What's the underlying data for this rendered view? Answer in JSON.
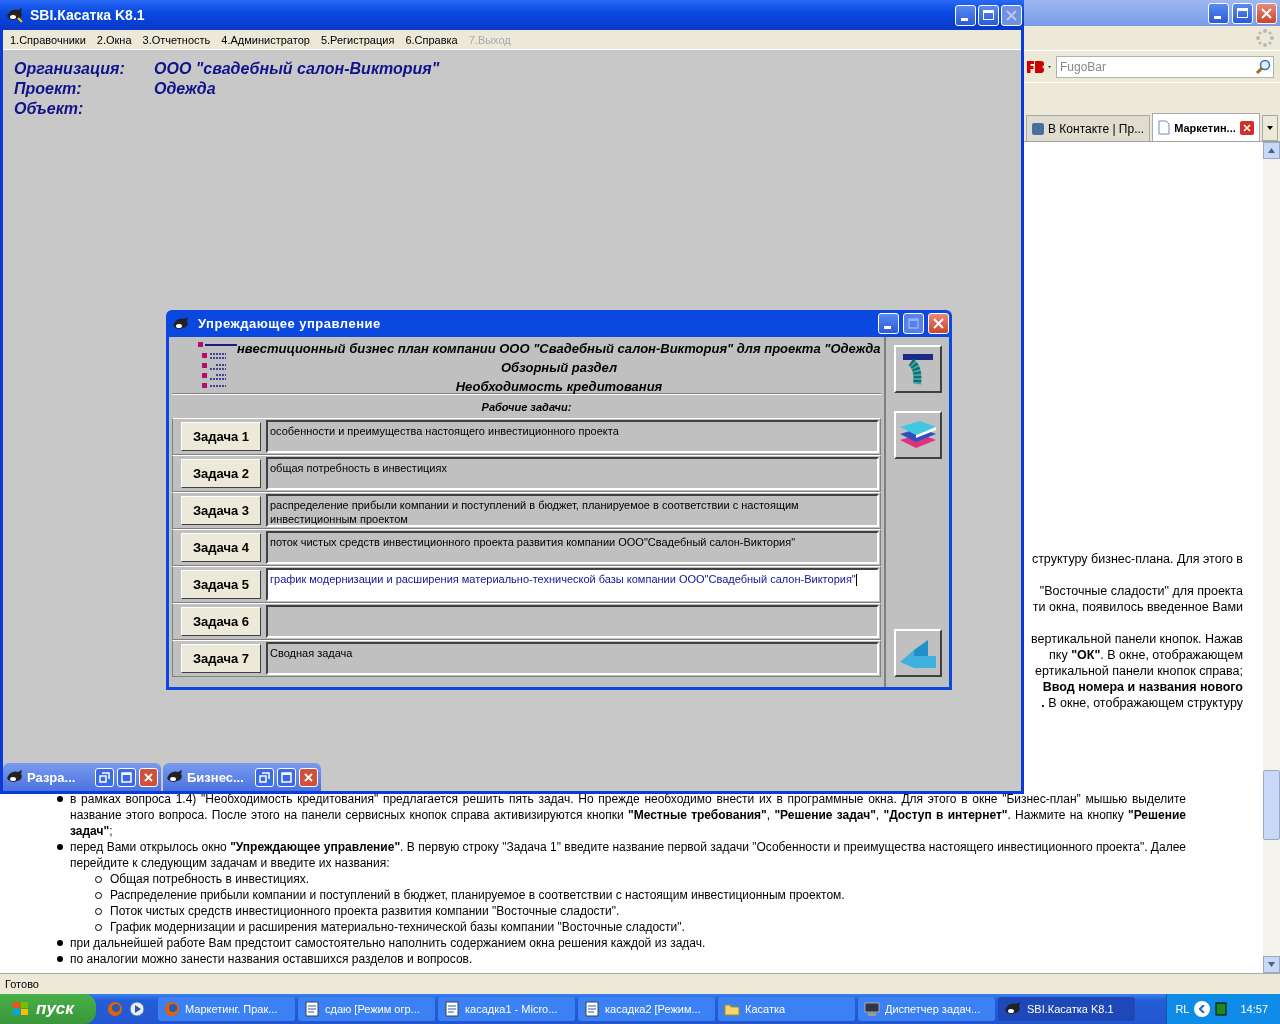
{
  "browser": {
    "search": {
      "placeholder": "FugoBar"
    },
    "tabs": [
      {
        "label": "В Контакте | Пр...",
        "selected": false
      },
      {
        "label": "Маркетин...",
        "selected": true
      }
    ],
    "side_text": [
      [
        "структуру бизнес-плана. Для этого в"
      ],
      [
        "\"Восточные сладости\" для проекта",
        "ти окна, появилось введенное Вами"
      ],
      [
        "вертикальной панели кнопок. Нажав",
        "пку **\"ОК\"**. В окне, отображающем",
        "ертикальной панели кнопок справа;",
        "**Ввод номера и названия нового**",
        "**.** В окне, отображающем структуру"
      ]
    ],
    "bullets": [
      {
        "text": "в рамках вопроса 1.4) \"Необходимость кредитования\" предлагается решить пять задач. Но прежде необходимо внести их в программные окна. Для этого в окне \"Бизнес-план\" мышью выделите название этого вопроса. После этого на панели сервисных кнопок справа активизируются кнопки **\"Местные требования\"**, **\"Решение задач\"**, **\"Доступ в интернет\"**. Нажмите на кнопку **\"Решение задач\"**;"
      },
      {
        "text": "перед Вами открылось окно **\"Упреждающее управление\"**. В первую строку \"Задача 1\" введите название первой задачи \"Особенности и преимущества настоящего инвестиционного проекта\". Далее перейдите к следующим задачам и введите их названия:",
        "children": [
          {
            "text": "Общая потребность в инвестициях."
          },
          {
            "text": "Распределение прибыли компании и поступлений в бюджет, планируемое в соответствии с настоящим инвестиционным проектом."
          },
          {
            "text": "Поток чистых средств инвестиционного проекта развития компании \"Восточные сладости\"."
          },
          {
            "text": "График модернизации и расширения материально-технической базы компании \"Восточные сладости\"."
          }
        ]
      },
      {
        "text": "при дальнейшей работе Вам предстоит самостоятельно наполнить содержанием окна решения каждой из задач."
      },
      {
        "text": "по аналогии можно занести названия оставшихся разделов и вопросов."
      }
    ],
    "status_bar": "Готово"
  },
  "app_window": {
    "title": "SBI.Касатка K8.1",
    "menu": [
      {
        "label": "1.Справочники",
        "disabled": false
      },
      {
        "label": "2.Окна",
        "disabled": false
      },
      {
        "label": "3.Отчетность",
        "disabled": false
      },
      {
        "label": "4.Администратор",
        "disabled": false
      },
      {
        "label": "5.Регистрация",
        "disabled": false
      },
      {
        "label": "6.Справка",
        "disabled": false
      },
      {
        "label": "7.Выход",
        "disabled": true
      }
    ],
    "info": [
      {
        "label": "Организация:",
        "value": "ООО \"свадебный салон-Виктория\""
      },
      {
        "label": "Проект:",
        "value": "Одежда"
      },
      {
        "label": "Объект:"
      }
    ],
    "minimized": [
      {
        "title": "Разра..."
      },
      {
        "title": "Бизнес..."
      }
    ]
  },
  "dialog": {
    "title": "Упреждающее управление",
    "header_lines": [
      "нвестиционный бизнес план компании ООО \"Свадебный салон-Виктория\" для проекта \"Одежда",
      "Обзорный раздел",
      "Необходимость кредитования"
    ],
    "section_title": "Рабочие задачи:",
    "tasks": [
      {
        "button": "Задача 1",
        "value": "особенности и преимущества настоящего инвестиционного проекта",
        "focused": false
      },
      {
        "button": "Задача 2",
        "value": "общая потребность в инвестициях",
        "focused": false
      },
      {
        "button": "Задача 3",
        "value": "распределение прибыли компании и поступлений в бюджет, планируемое в соответствии с настоящим инвестиционным проектом",
        "focused": false
      },
      {
        "button": "Задача 4",
        "value": "поток чистых средств инвестиционного проекта развития компании ООО\"Свадебный салон-Виктория\"",
        "focused": false
      },
      {
        "button": "Задача 5",
        "value": "график модернизации и расширения материально-технической базы компании ООО\"Свадебный салон-Виктория\"",
        "focused": true
      },
      {
        "button": "Задача 6",
        "focused": false
      },
      {
        "button": "Задача 7",
        "value": "Сводная задача",
        "focused": false
      }
    ]
  },
  "taskbar": {
    "start": "пуск",
    "tasks": [
      {
        "label": "Маркетинг. Прак...",
        "kind": "browser",
        "selected": false
      },
      {
        "label": "сдаю [Режим огр...",
        "kind": "document",
        "selected": false
      },
      {
        "label": "касадка1 - Micro...",
        "kind": "document",
        "selected": false
      },
      {
        "label": "касадка2 [Режим...",
        "kind": "document",
        "selected": false
      },
      {
        "label": "Касатка",
        "kind": "folder",
        "selected": false
      },
      {
        "label": "Диспетчер задач...",
        "kind": "monitor",
        "selected": false
      },
      {
        "label": "SBI.Касатка K8.1",
        "kind": "app",
        "selected": true
      }
    ],
    "language": "RL",
    "clock": "14:57"
  }
}
